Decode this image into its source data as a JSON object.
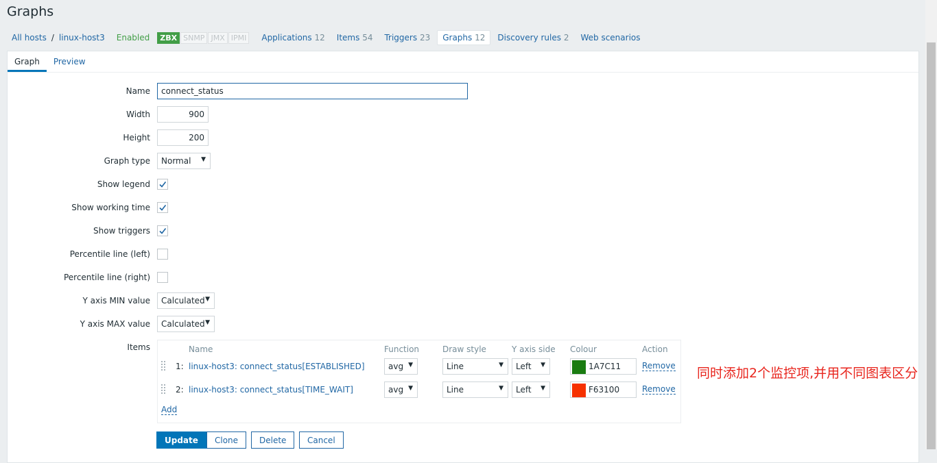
{
  "page": {
    "title": "Graphs"
  },
  "host_nav": {
    "all_hosts": "All hosts",
    "separator": "/",
    "host": "linux-host3",
    "status": "Enabled",
    "availability": [
      "ZBX",
      "SNMP",
      "JMX",
      "IPMI"
    ],
    "tabs": [
      {
        "label": "Applications",
        "count": "12"
      },
      {
        "label": "Items",
        "count": "54"
      },
      {
        "label": "Triggers",
        "count": "23"
      },
      {
        "label": "Graphs",
        "count": "12",
        "active": true
      },
      {
        "label": "Discovery rules",
        "count": "2"
      },
      {
        "label": "Web scenarios",
        "count": ""
      }
    ]
  },
  "form_tabs": [
    "Graph",
    "Preview"
  ],
  "form": {
    "name": {
      "label": "Name",
      "value": "connect_status"
    },
    "width": {
      "label": "Width",
      "value": "900"
    },
    "height": {
      "label": "Height",
      "value": "200"
    },
    "graph_type": {
      "label": "Graph type",
      "value": "Normal"
    },
    "show_legend": {
      "label": "Show legend",
      "checked": true
    },
    "show_working_time": {
      "label": "Show working time",
      "checked": true
    },
    "show_triggers": {
      "label": "Show triggers",
      "checked": true
    },
    "percentile_left": {
      "label": "Percentile line (left)",
      "checked": false
    },
    "percentile_right": {
      "label": "Percentile line (right)",
      "checked": false
    },
    "y_min": {
      "label": "Y axis MIN value",
      "value": "Calculated"
    },
    "y_max": {
      "label": "Y axis MAX value",
      "value": "Calculated"
    },
    "items_label": "Items"
  },
  "items": {
    "headers": {
      "name": "Name",
      "function": "Function",
      "draw_style": "Draw style",
      "y_axis_side": "Y axis side",
      "colour": "Colour",
      "action": "Action"
    },
    "rows": [
      {
        "no": "1:",
        "name": "linux-host3: connect_status[ESTABLISHED]",
        "function": "avg",
        "draw_style": "Line",
        "y_axis_side": "Left",
        "colour": "1A7C11",
        "colour_hex": "#1A7C11",
        "action": "Remove"
      },
      {
        "no": "2:",
        "name": "linux-host3: connect_status[TIME_WAIT]",
        "function": "avg",
        "draw_style": "Line",
        "y_axis_side": "Left",
        "colour": "F63100",
        "colour_hex": "#F63100",
        "action": "Remove"
      }
    ],
    "add": "Add"
  },
  "annotation": "同时添加2个监控项,并用不同图表区分",
  "buttons": {
    "update": "Update",
    "clone": "Clone",
    "delete": "Delete",
    "cancel": "Cancel"
  }
}
